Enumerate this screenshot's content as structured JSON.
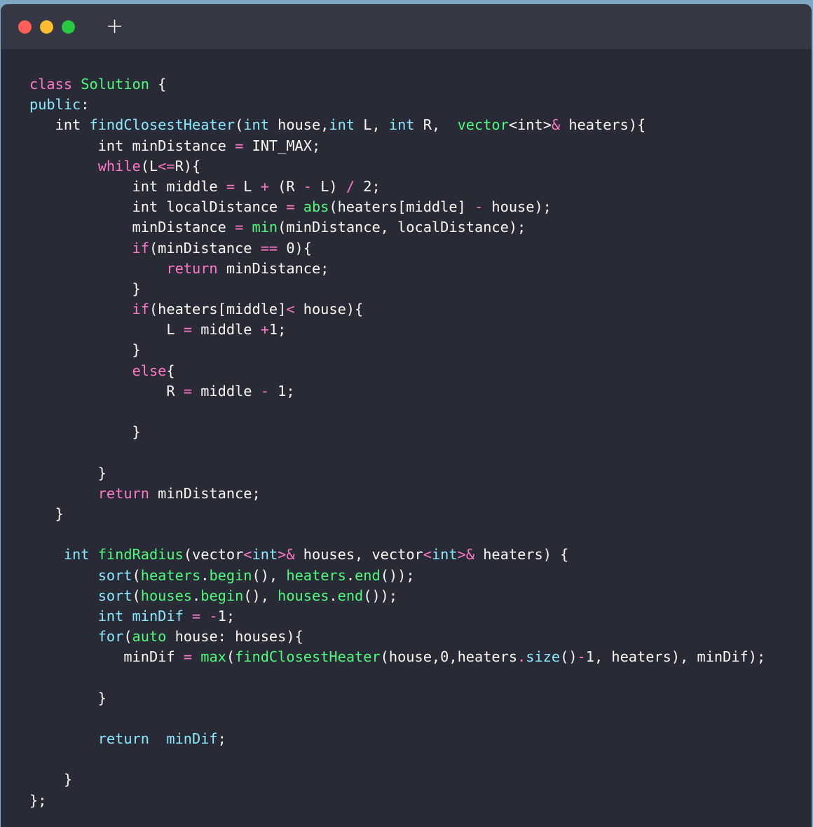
{
  "window": {
    "colors": {
      "bg": "#282a36",
      "titlebar": "#353744",
      "text": "#f8f8f2",
      "keyword": "#ff79c6",
      "type": "#8be9fd",
      "function": "#50fa7b"
    },
    "titlebar": {
      "traffic_lights": [
        "close",
        "minimize",
        "maximize"
      ],
      "new_tab_label": "+"
    }
  },
  "editor": {
    "lines": [
      [
        [
          "kw",
          "class"
        ],
        [
          "tx",
          " "
        ],
        [
          "fn",
          "Solution"
        ],
        [
          "tx",
          " {"
        ]
      ],
      [
        [
          "ty",
          "public"
        ],
        [
          "tx",
          ":"
        ]
      ],
      [
        [
          "tx",
          "   int "
        ],
        [
          "ty",
          "findClosestHeater"
        ],
        [
          "tx",
          "("
        ],
        [
          "ty",
          "int"
        ],
        [
          "tx",
          " house,"
        ],
        [
          "ty",
          "int"
        ],
        [
          "tx",
          " L, "
        ],
        [
          "ty",
          "int"
        ],
        [
          "tx",
          " R,  "
        ],
        [
          "fn",
          "vector"
        ],
        [
          "tx",
          "<int>"
        ],
        [
          "kw",
          "&"
        ],
        [
          "tx",
          " heaters){"
        ]
      ],
      [
        [
          "tx",
          "        int minDistance "
        ],
        [
          "kw",
          "="
        ],
        [
          "tx",
          " INT_MAX;"
        ]
      ],
      [
        [
          "tx",
          "        "
        ],
        [
          "kw",
          "while"
        ],
        [
          "tx",
          "(L"
        ],
        [
          "kw",
          "<="
        ],
        [
          "tx",
          "R){"
        ]
      ],
      [
        [
          "tx",
          "            int middle "
        ],
        [
          "kw",
          "="
        ],
        [
          "tx",
          " L "
        ],
        [
          "kw",
          "+"
        ],
        [
          "tx",
          " (R "
        ],
        [
          "kw",
          "-"
        ],
        [
          "tx",
          " L) "
        ],
        [
          "kw",
          "/"
        ],
        [
          "tx",
          " 2;"
        ]
      ],
      [
        [
          "tx",
          "            int localDistance "
        ],
        [
          "kw",
          "="
        ],
        [
          "tx",
          " "
        ],
        [
          "fn",
          "abs"
        ],
        [
          "tx",
          "(heaters[middle] "
        ],
        [
          "kw",
          "-"
        ],
        [
          "tx",
          " house);"
        ]
      ],
      [
        [
          "tx",
          "            minDistance "
        ],
        [
          "kw",
          "="
        ],
        [
          "tx",
          " "
        ],
        [
          "fn",
          "min"
        ],
        [
          "tx",
          "(minDistance, localDistance);"
        ]
      ],
      [
        [
          "tx",
          "            "
        ],
        [
          "kw",
          "if"
        ],
        [
          "tx",
          "(minDistance "
        ],
        [
          "kw",
          "=="
        ],
        [
          "tx",
          " 0){"
        ]
      ],
      [
        [
          "tx",
          "                "
        ],
        [
          "kw",
          "return"
        ],
        [
          "tx",
          " minDistance;"
        ]
      ],
      [
        [
          "tx",
          "            }"
        ]
      ],
      [
        [
          "tx",
          "            "
        ],
        [
          "kw",
          "if"
        ],
        [
          "tx",
          "(heaters[middle]"
        ],
        [
          "kw",
          "<"
        ],
        [
          "tx",
          " house){"
        ]
      ],
      [
        [
          "tx",
          "                L "
        ],
        [
          "kw",
          "="
        ],
        [
          "tx",
          " middle "
        ],
        [
          "kw",
          "+"
        ],
        [
          "tx",
          "1;"
        ]
      ],
      [
        [
          "tx",
          "            }"
        ]
      ],
      [
        [
          "tx",
          "            "
        ],
        [
          "kw",
          "else"
        ],
        [
          "tx",
          "{"
        ]
      ],
      [
        [
          "tx",
          "                R "
        ],
        [
          "kw",
          "="
        ],
        [
          "tx",
          " middle "
        ],
        [
          "kw",
          "-"
        ],
        [
          "tx",
          " 1;"
        ]
      ],
      [],
      [
        [
          "tx",
          "            }"
        ]
      ],
      [],
      [
        [
          "tx",
          "        }"
        ]
      ],
      [
        [
          "tx",
          "        "
        ],
        [
          "kw",
          "return"
        ],
        [
          "tx",
          " minDistance;"
        ]
      ],
      [
        [
          "tx",
          "   }"
        ]
      ],
      [],
      [
        [
          "tx",
          "    "
        ],
        [
          "ty",
          "int"
        ],
        [
          "tx",
          " "
        ],
        [
          "fn",
          "findRadius"
        ],
        [
          "tx",
          "(vector"
        ],
        [
          "kw",
          "<"
        ],
        [
          "ty",
          "int"
        ],
        [
          "kw",
          ">&"
        ],
        [
          "tx",
          " houses, vector"
        ],
        [
          "kw",
          "<"
        ],
        [
          "ty",
          "int"
        ],
        [
          "kw",
          ">&"
        ],
        [
          "tx",
          " heaters) {"
        ]
      ],
      [
        [
          "tx",
          "        "
        ],
        [
          "ty",
          "sort"
        ],
        [
          "tx",
          "("
        ],
        [
          "fn",
          "heaters"
        ],
        [
          "tx",
          "."
        ],
        [
          "fn",
          "begin"
        ],
        [
          "tx",
          "(), "
        ],
        [
          "fn",
          "heaters"
        ],
        [
          "tx",
          "."
        ],
        [
          "fn",
          "end"
        ],
        [
          "tx",
          "());"
        ]
      ],
      [
        [
          "tx",
          "        "
        ],
        [
          "ty",
          "sort"
        ],
        [
          "tx",
          "("
        ],
        [
          "fn",
          "houses"
        ],
        [
          "tx",
          "."
        ],
        [
          "fn",
          "begin"
        ],
        [
          "tx",
          "(), "
        ],
        [
          "fn",
          "houses"
        ],
        [
          "tx",
          "."
        ],
        [
          "fn",
          "end"
        ],
        [
          "tx",
          "());"
        ]
      ],
      [
        [
          "tx",
          "        "
        ],
        [
          "ty",
          "int minDif"
        ],
        [
          "tx",
          " "
        ],
        [
          "kw",
          "="
        ],
        [
          "tx",
          " "
        ],
        [
          "kw",
          "-"
        ],
        [
          "tx",
          "1;"
        ]
      ],
      [
        [
          "tx",
          "        "
        ],
        [
          "ty",
          "for"
        ],
        [
          "tx",
          "("
        ],
        [
          "fn",
          "auto"
        ],
        [
          "tx",
          " house: houses){"
        ]
      ],
      [
        [
          "tx",
          "           minDif "
        ],
        [
          "kw",
          "="
        ],
        [
          "tx",
          " "
        ],
        [
          "fn",
          "max"
        ],
        [
          "tx",
          "("
        ],
        [
          "fn",
          "findClosestHeater"
        ],
        [
          "tx",
          "(house,0,heaters"
        ],
        [
          "kw",
          "."
        ],
        [
          "ty",
          "size"
        ],
        [
          "tx",
          "()"
        ],
        [
          "kw",
          "-"
        ],
        [
          "tx",
          "1, heaters), minDif);"
        ]
      ],
      [],
      [
        [
          "tx",
          "        }"
        ]
      ],
      [],
      [
        [
          "tx",
          "        "
        ],
        [
          "ty",
          "return"
        ],
        [
          "tx",
          "  "
        ],
        [
          "ty",
          "minDif"
        ],
        [
          "tx",
          ";"
        ]
      ],
      [],
      [
        [
          "tx",
          "    }"
        ]
      ],
      [
        [
          "tx",
          "};"
        ]
      ]
    ]
  }
}
